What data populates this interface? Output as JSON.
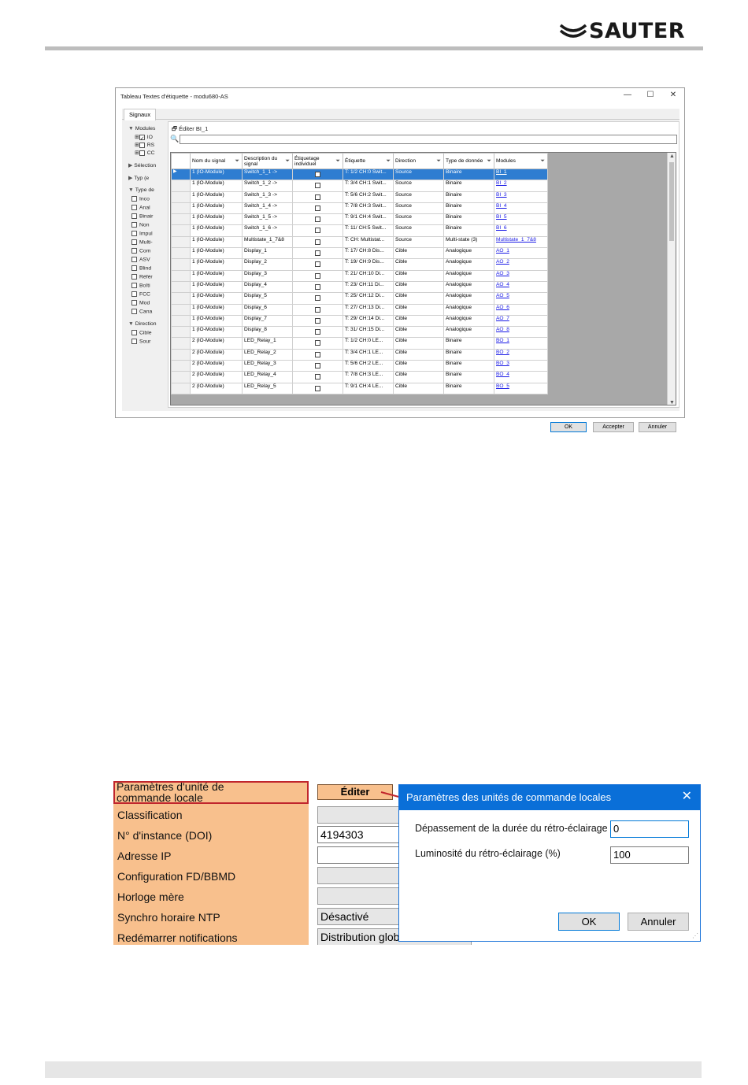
{
  "header": {
    "brand": "SAUTER"
  },
  "window": {
    "title": "Tableau Textes d'étiquette - modu680-AS",
    "controls": {
      "minimize": "—",
      "maximize": "☐",
      "close": "✕"
    },
    "tab": "Signaux",
    "filter_panel": {
      "modules_label": "Modules",
      "module_items": [
        "IO",
        "RS",
        "CC"
      ],
      "selection_label": "Sélection",
      "typ_label": "Typ (e",
      "type_label": "Type de",
      "type_items": [
        "Inco",
        "Anal",
        "Binair",
        "Non",
        "Impul",
        "Multi-",
        "Com",
        "ASV",
        "Blind",
        "Référ",
        "Boîti",
        "FCC",
        "Mod",
        "Cana"
      ],
      "direction_label": "Direction",
      "direction_items": [
        "Cible",
        "Sour"
      ]
    },
    "edit_label": "Éditer BI_1",
    "columns": [
      "Nom du signal",
      "Description du signal",
      "Étiquetage individuel",
      "Étiquette",
      "Direction",
      "Type de donnée",
      "Modules"
    ],
    "rows": [
      [
        "1 (IO-Module)",
        "Switch_1_1 ->",
        "T: 1/2 CH:0 Swit...",
        "Source",
        "Binaire",
        "BI_1"
      ],
      [
        "1 (IO-Module)",
        "Switch_1_2 ->",
        "T: 3/4 CH:1 Swit...",
        "Source",
        "Binaire",
        "BI_2"
      ],
      [
        "1 (IO-Module)",
        "Switch_1_3 ->",
        "T: 5/6 CH:2 Swit...",
        "Source",
        "Binaire",
        "BI_3"
      ],
      [
        "1 (IO-Module)",
        "Switch_1_4 ->",
        "T: 7/8 CH:3 Swit...",
        "Source",
        "Binaire",
        "BI_4"
      ],
      [
        "1 (IO-Module)",
        "Switch_1_5 ->",
        "T: 9/1 CH:4 Swit...",
        "Source",
        "Binaire",
        "BI_5"
      ],
      [
        "1 (IO-Module)",
        "Switch_1_6 ->",
        "T: 11/ CH:5 Swit...",
        "Source",
        "Binaire",
        "BI_6"
      ],
      [
        "1 (IO-Module)",
        "Multistate_1_7&8",
        "T: CH: Multistat...",
        "Source",
        "Multi-state (3)",
        "Multistate_1_7&8"
      ],
      [
        "1 (IO-Module)",
        "Display_1",
        "T: 17/ CH:8 Dis...",
        "Cible",
        "Analogique",
        "AO_1"
      ],
      [
        "1 (IO-Module)",
        "Display_2",
        "T: 19/ CH:9 Dis...",
        "Cible",
        "Analogique",
        "AO_2"
      ],
      [
        "1 (IO-Module)",
        "Display_3",
        "T: 21/ CH:10 Di...",
        "Cible",
        "Analogique",
        "AO_3"
      ],
      [
        "1 (IO-Module)",
        "Display_4",
        "T: 23/ CH:11 Di...",
        "Cible",
        "Analogique",
        "AO_4"
      ],
      [
        "1 (IO-Module)",
        "Display_5",
        "T: 25/ CH:12 Di...",
        "Cible",
        "Analogique",
        "AO_5"
      ],
      [
        "1 (IO-Module)",
        "Display_6",
        "T: 27/ CH:13 Di...",
        "Cible",
        "Analogique",
        "AO_6"
      ],
      [
        "1 (IO-Module)",
        "Display_7",
        "T: 29/ CH:14 Di...",
        "Cible",
        "Analogique",
        "AO_7"
      ],
      [
        "1 (IO-Module)",
        "Display_8",
        "T: 31/ CH:15 Di...",
        "Cible",
        "Analogique",
        "AO_8"
      ],
      [
        "2 (IO-Module)",
        "LED_Relay_1",
        "T: 1/2 CH:0 LE...",
        "Cible",
        "Binaire",
        "BO_1"
      ],
      [
        "2 (IO-Module)",
        "LED_Relay_2",
        "T: 3/4 CH:1 LE...",
        "Cible",
        "Binaire",
        "BO_2"
      ],
      [
        "2 (IO-Module)",
        "LED_Relay_3",
        "T: 5/6 CH:2 LE...",
        "Cible",
        "Binaire",
        "BO_3"
      ],
      [
        "2 (IO-Module)",
        "LED_Relay_4",
        "T: 7/8 CH:3 LE...",
        "Cible",
        "Binaire",
        "BO_4"
      ],
      [
        "2 (IO-Module)",
        "LED_Relay_5",
        "T: 9/1 CH:4 LE...",
        "Cible",
        "Binaire",
        "BO_5"
      ]
    ],
    "buttons": {
      "ok": "OK",
      "apply": "Accepter",
      "cancel": "Annuler"
    }
  },
  "properties": {
    "first_label": "Paramètres d'unité de commande locale",
    "edit_button": "Éditer",
    "labels": [
      "Classification",
      "N° d'instance (DOI)",
      "Adresse IP",
      "Configuration FD/BBMD",
      "Horloge mère",
      "Synchro horaire NTP",
      "Redémarrer notifications"
    ],
    "values": {
      "doi": "4194303",
      "ntp": "Désactivé",
      "restart": "Distribution glob"
    }
  },
  "dialog": {
    "title": "Paramètres des unités de commande locales",
    "backlight_timeout_label": "Dépassement de la durée du rétro-éclairage (s)",
    "backlight_timeout_value": "0",
    "brightness_label": "Luminosité du rétro-éclairage (%)",
    "brightness_value": "100",
    "ok": "OK",
    "cancel": "Annuler"
  },
  "colors": {
    "property_label_bg": "#f8c08d",
    "highlight_border": "#c0262d",
    "dialog_title_bg": "#0a6fd8",
    "selected_row": "#2e7dd1"
  }
}
